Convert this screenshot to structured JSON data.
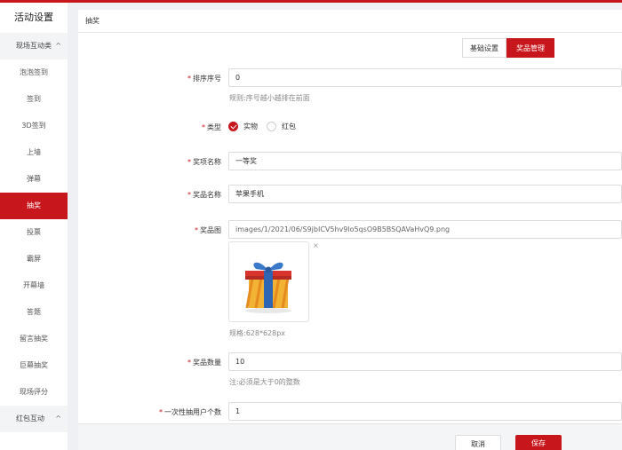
{
  "sidebar": {
    "title": "活动设置",
    "groups": [
      {
        "label": "现场互动类",
        "chevron": "^"
      },
      {
        "label": "红包互动",
        "chevron": "^"
      }
    ],
    "items": [
      "泡泡签到",
      "签到",
      "3D签到",
      "上墙",
      "弹幕",
      "抽奖",
      "投票",
      "霸屏",
      "开幕墙",
      "答题",
      "留言抽奖",
      "巨幕抽奖",
      "现场评分"
    ],
    "active_item": "抽奖"
  },
  "breadcrumb": "抽奖",
  "tabs": [
    "基础设置",
    "奖品管理"
  ],
  "form": {
    "sort": {
      "label": "排序序号",
      "value": "0",
      "hint": "规则:序号越小越排在前面"
    },
    "type": {
      "label": "类型",
      "options": [
        "实物",
        "红包"
      ],
      "selected": "实物"
    },
    "award_name": {
      "label": "奖项名称",
      "value": "一等奖"
    },
    "prize_name": {
      "label": "奖品名称",
      "value": "苹果手机"
    },
    "prize_image": {
      "label": "奖品图",
      "value": "images/1/2021/06/S9jbICV5hv9lo5qsO9B5BSQAVaHvQ9.png",
      "hint": "规格:628*628px",
      "remove": "×",
      "icon": "gift-box-icon"
    },
    "quantity": {
      "label": "奖品数量",
      "value": "10",
      "hint": "注:必须是大于0的整数"
    },
    "per_draw": {
      "label": "一次性抽用户个数",
      "value": "1"
    },
    "required_mark": "*"
  },
  "buttons": {
    "cancel": "取消",
    "save": "保存"
  },
  "colors": {
    "accent": "#c8161d"
  }
}
